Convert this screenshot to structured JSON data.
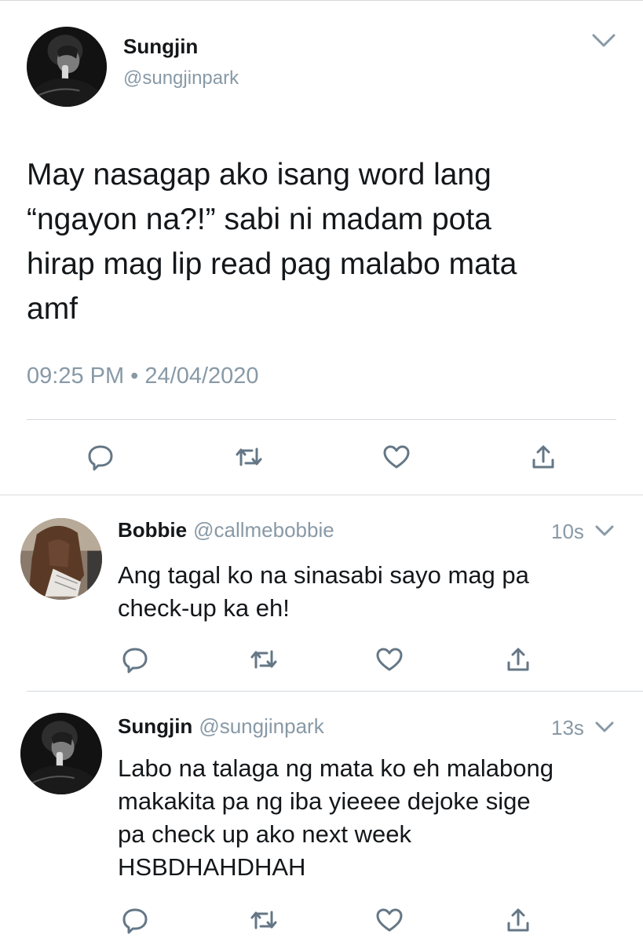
{
  "main_tweet": {
    "author_name": "Sungjin",
    "handle": "@sungjinpark",
    "text_lines": [
      "May nasagap ako isang word lang",
      "“ngayon na?!” sabi ni madam pota",
      "hirap mag lip read pag malabo mata",
      "amf"
    ],
    "timestamp": "09:25 PM • 24/04/2020"
  },
  "replies": [
    {
      "author_name": "Bobbie",
      "handle": "@callmebobbie",
      "time": "10s",
      "text_lines": [
        "Ang tagal ko na sinasabi sayo mag pa",
        "check-up ka eh!"
      ]
    },
    {
      "author_name": "Sungjin",
      "handle": "@sungjinpark",
      "time": "13s",
      "text_lines": [
        "Labo na talaga ng mata ko eh malabong",
        "makakita pa ng iba yieeee dejoke sige",
        "pa check up ako next week",
        "HSBDHAHDHAH"
      ]
    }
  ],
  "icons": {
    "reply": "reply-bubble-icon",
    "retweet": "retweet-arrows-icon",
    "like": "heart-icon",
    "share": "share-upload-icon",
    "more": "chevron-down-icon"
  },
  "colors": {
    "text": "#14171a",
    "secondary": "#8899a6",
    "icon": "#657786",
    "divider": "#d4d9dd"
  }
}
